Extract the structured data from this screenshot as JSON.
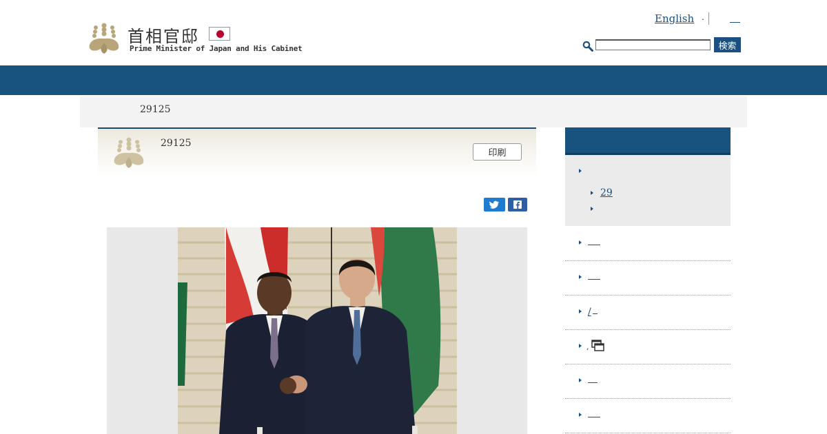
{
  "header": {
    "site_title_jp": "首相官邸",
    "site_title_en": "Prime Minister of Japan and His Cabinet",
    "lang_link": "English",
    "lang_dot": ".",
    "search": {
      "placeholder": "",
      "button_label": "検索"
    }
  },
  "breadcrumb": {
    "current": "29125"
  },
  "article": {
    "title": "29125",
    "print_label": "印刷"
  },
  "share": {
    "twitter_icon": "twitter-icon",
    "facebook_icon": "facebook-icon"
  },
  "sidebar": {
    "sub_link": "29",
    "row_slash": "/",
    "row_dot": ","
  },
  "colors": {
    "brand": "#17537e",
    "link": "#1a4f80",
    "search_button": "#1a4f80"
  }
}
